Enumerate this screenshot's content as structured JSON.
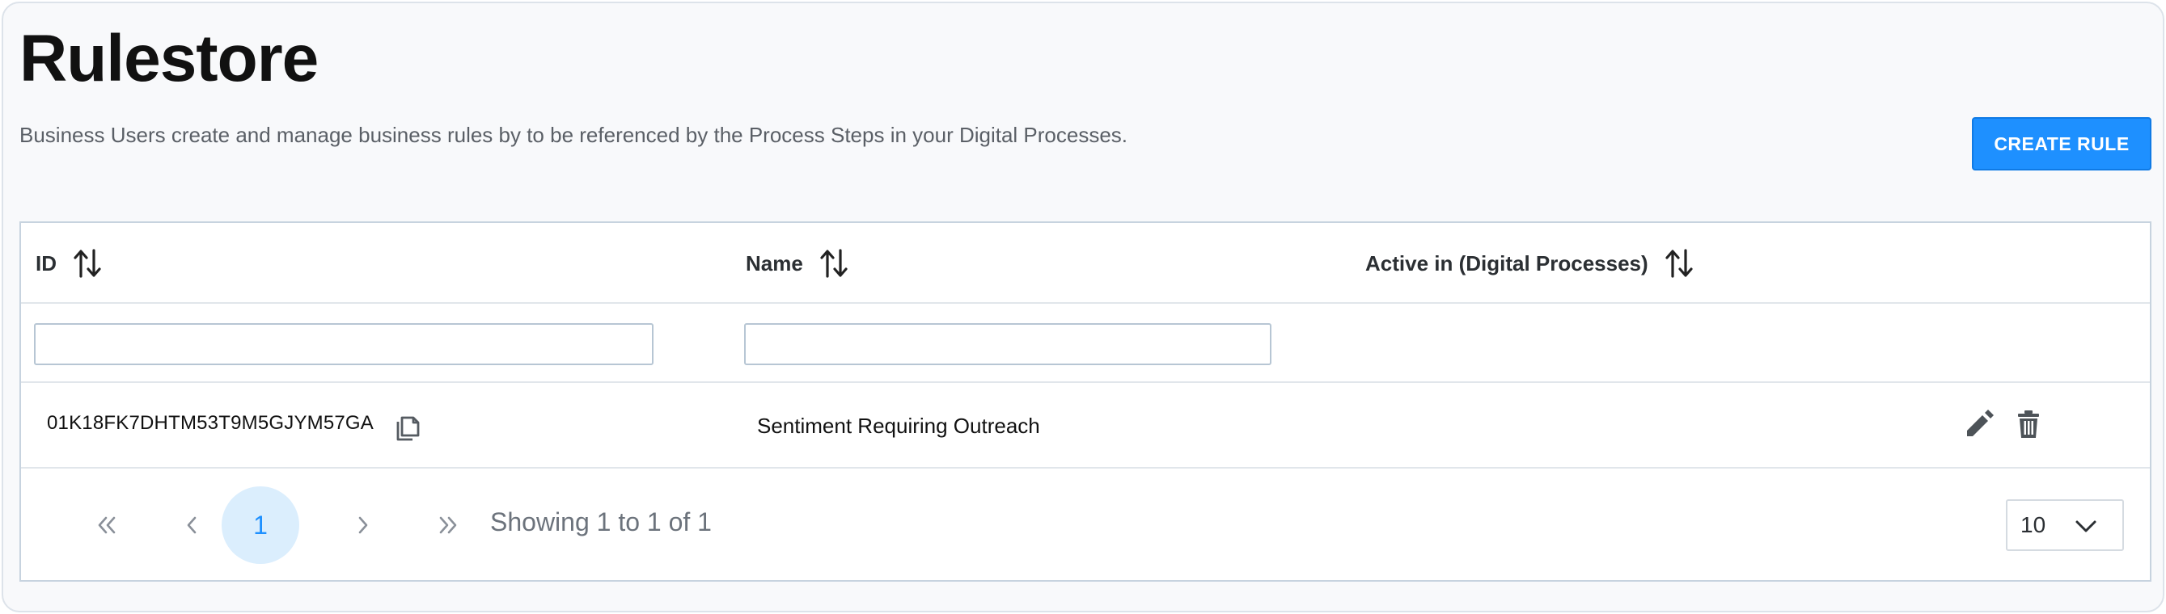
{
  "page": {
    "title": "Rulestore",
    "subtitle": "Business Users create and manage business rules by to be referenced by the Process Steps in your Digital Processes.",
    "create_button": "CREATE RULE"
  },
  "table": {
    "columns": [
      {
        "label": "ID",
        "icon": "sort-icon"
      },
      {
        "label": "Name",
        "icon": "sort-icon"
      },
      {
        "label": "Active in (Digital Processes)",
        "icon": "sort-icon"
      }
    ],
    "filters": {
      "id_value": "",
      "name_value": ""
    },
    "rows": [
      {
        "id": "01K18FK7DHTM53T9M5GJYM57GA",
        "name": "Sentiment Requiring Outreach",
        "active_in": ""
      }
    ]
  },
  "pagination": {
    "first_icon": "double-chevron-left-icon",
    "prev_icon": "chevron-left-icon",
    "current_page": "1",
    "next_icon": "chevron-right-icon",
    "last_icon": "double-chevron-right-icon",
    "showing": "Showing 1 to 1 of 1",
    "per_page": "10"
  },
  "colors": {
    "accent": "#1e90ff",
    "active_page_bg": "#dbeefd",
    "border": "#c7d3df"
  }
}
